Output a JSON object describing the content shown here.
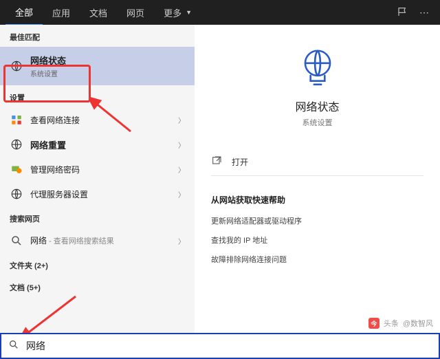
{
  "tabs": {
    "all": "全部",
    "apps": "应用",
    "docs": "文档",
    "web": "网页",
    "more": "更多"
  },
  "left": {
    "best_label": "最佳匹配",
    "best": {
      "title": "网络状态",
      "sub": "系统设置"
    },
    "settings_label": "设置",
    "items": [
      {
        "title": "查看网络连接"
      },
      {
        "title": "网络重置"
      },
      {
        "title": "管理网络密码"
      },
      {
        "title": "代理服务器设置"
      }
    ],
    "search_web_label": "搜索网页",
    "web_item": {
      "title": "网络",
      "suffix": " - 查看网络搜索结果"
    },
    "folders_label": "文件夹 (2+)",
    "docs_label": "文档 (5+)"
  },
  "detail": {
    "title": "网络状态",
    "sub": "系统设置",
    "open": "打开",
    "help_heading": "从网站获取快速帮助",
    "links": [
      "更新网络适配器或驱动程序",
      "查找我的 IP 地址",
      "故障排除网络连接问题"
    ]
  },
  "search": {
    "placeholder": "",
    "value": "网络"
  },
  "watermark": {
    "prefix": "头条",
    "author": "@数智风"
  }
}
